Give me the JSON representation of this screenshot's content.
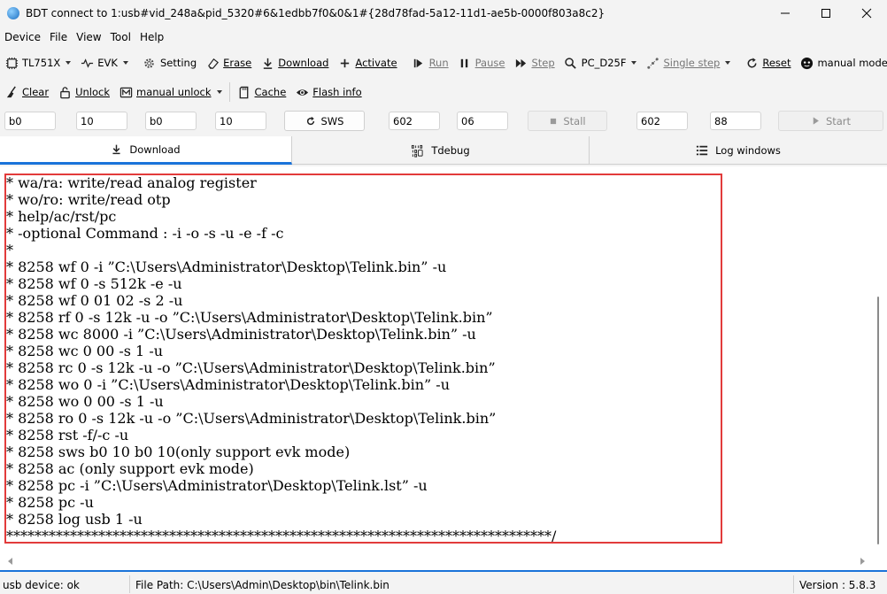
{
  "window": {
    "title": "BDT connect to 1:usb#vid_248a&pid_5320#6&1edbb7f0&0&1#{28d78fad-5a12-11d1-ae5b-0000f803a8c2}"
  },
  "menu": [
    "Device",
    "File",
    "View",
    "Tool",
    "Help"
  ],
  "toolbar1": {
    "chip": "TL751X",
    "board": "EVK",
    "setting": "Setting",
    "erase": "Erase",
    "download": "Download",
    "activate": "Activate",
    "run": "Run",
    "pause": "Pause",
    "step": "Step",
    "pc": "PC_D25F",
    "single_step": "Single step",
    "reset": "Reset",
    "mode": "manual mode"
  },
  "toolbar2": {
    "clear": "Clear",
    "unlock": "Unlock",
    "manual_unlock": "manual unlock",
    "cache": "Cache",
    "flash_info": "Flash info"
  },
  "inputs": {
    "f1": "b0",
    "f2": "10",
    "f3": "b0",
    "f4": "10",
    "sws_button": "SWS",
    "f5": "602",
    "f6": "06",
    "stall_button": "Stall",
    "f7": "602",
    "f8": "88",
    "start_button": "Start"
  },
  "tabs": {
    "download": "Download",
    "tdebug": "Tdebug",
    "log": "Log windows"
  },
  "console": {
    "lines": [
      "* wa/ra: write/read analog register",
      "* wo/ro: write/read otp",
      "* help/ac/rst/pc",
      "* -optional Command : -i -o -s -u -e -f -c",
      "*",
      "* 8258 wf 0 -i ”C:\\Users\\Administrator\\Desktop\\Telink.bin” -u",
      "* 8258 wf 0 -s 512k -e -u",
      "* 8258 wf 0 01 02 -s 2 -u",
      "* 8258 rf 0 -s 12k -u -o ”C:\\Users\\Administrator\\Desktop\\Telink.bin”",
      "* 8258 wc 8000 -i ”C:\\Users\\Administrator\\Desktop\\Telink.bin” -u",
      "* 8258 wc 0 00 -s 1 -u",
      "* 8258 rc 0 -s 12k -u -o ”C:\\Users\\Administrator\\Desktop\\Telink.bin”",
      "* 8258 wo 0 -i ”C:\\Users\\Administrator\\Desktop\\Telink.bin” -u",
      "* 8258 wo 0 00 -s 1 -u",
      "* 8258 ro 0 -s 12k -u -o ”C:\\Users\\Administrator\\Desktop\\Telink.bin”",
      "* 8258 rst -f/-c -u",
      "* 8258 sws b0 10 b0 10(only support evk mode)",
      "* 8258 ac (only support evk mode)",
      "* 8258 pc -i ”C:\\Users\\Administrator\\Desktop\\Telink.lst” -u",
      "* 8258 pc -u",
      "* 8258 log usb 1 -u",
      "*****************************************************************************/"
    ]
  },
  "status": {
    "device": "usb device: ok",
    "file_path": "File Path:  C:\\Users\\Admin\\Desktop\\bin\\Telink.bin",
    "version": "Version : 5.8.3"
  },
  "colors": {
    "accent": "#1a73d9",
    "highlight_box": "#e23b3b"
  }
}
